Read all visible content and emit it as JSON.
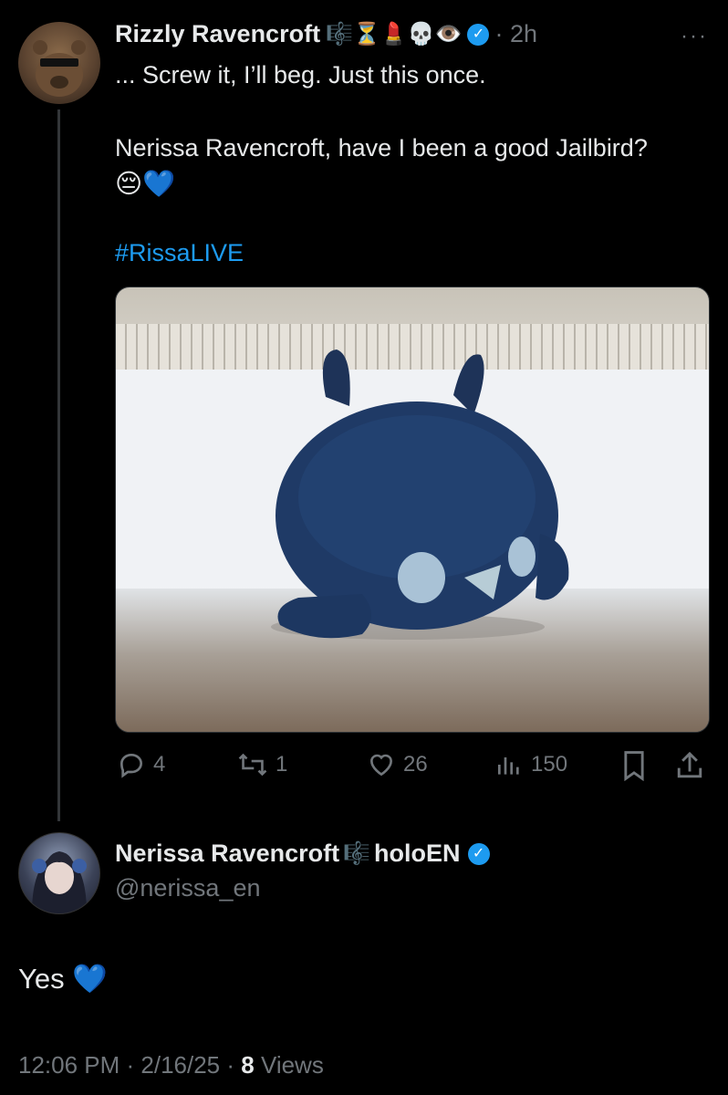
{
  "tweet": {
    "author_name": "Rizzly Ravencroft",
    "author_emoji": "🎼⏳💄💀👁️",
    "time": "· 2h",
    "more": "···",
    "line1": "... Screw it, I’ll beg. Just this once.",
    "line2": "Nerissa Ravencroft, have I been a good Jailbird?",
    "line3": "😔💙",
    "hashtag": "#RissaLIVE",
    "media_alt": "Blue bird plush in the snow",
    "stats": {
      "replies": "4",
      "reposts": "1",
      "likes": "26",
      "views": "150"
    }
  },
  "reply": {
    "author_name": "Nerissa Ravencroft",
    "author_emoji": "🎼",
    "author_suffix": "holoEN",
    "handle": "@nerissa_en",
    "text": "Yes 💙",
    "footer_time": "12:06 PM · 2/16/25 · ",
    "footer_views_count": "8",
    "footer_views_label": " Views"
  },
  "colors": {
    "background": "#000000",
    "text": "#e7e9ea",
    "muted": "#71767b",
    "accent": "#1d9bf0"
  },
  "icons": [
    "reply-icon",
    "repost-icon",
    "like-icon",
    "views-icon",
    "bookmark-icon",
    "share-icon",
    "verified-icon"
  ]
}
